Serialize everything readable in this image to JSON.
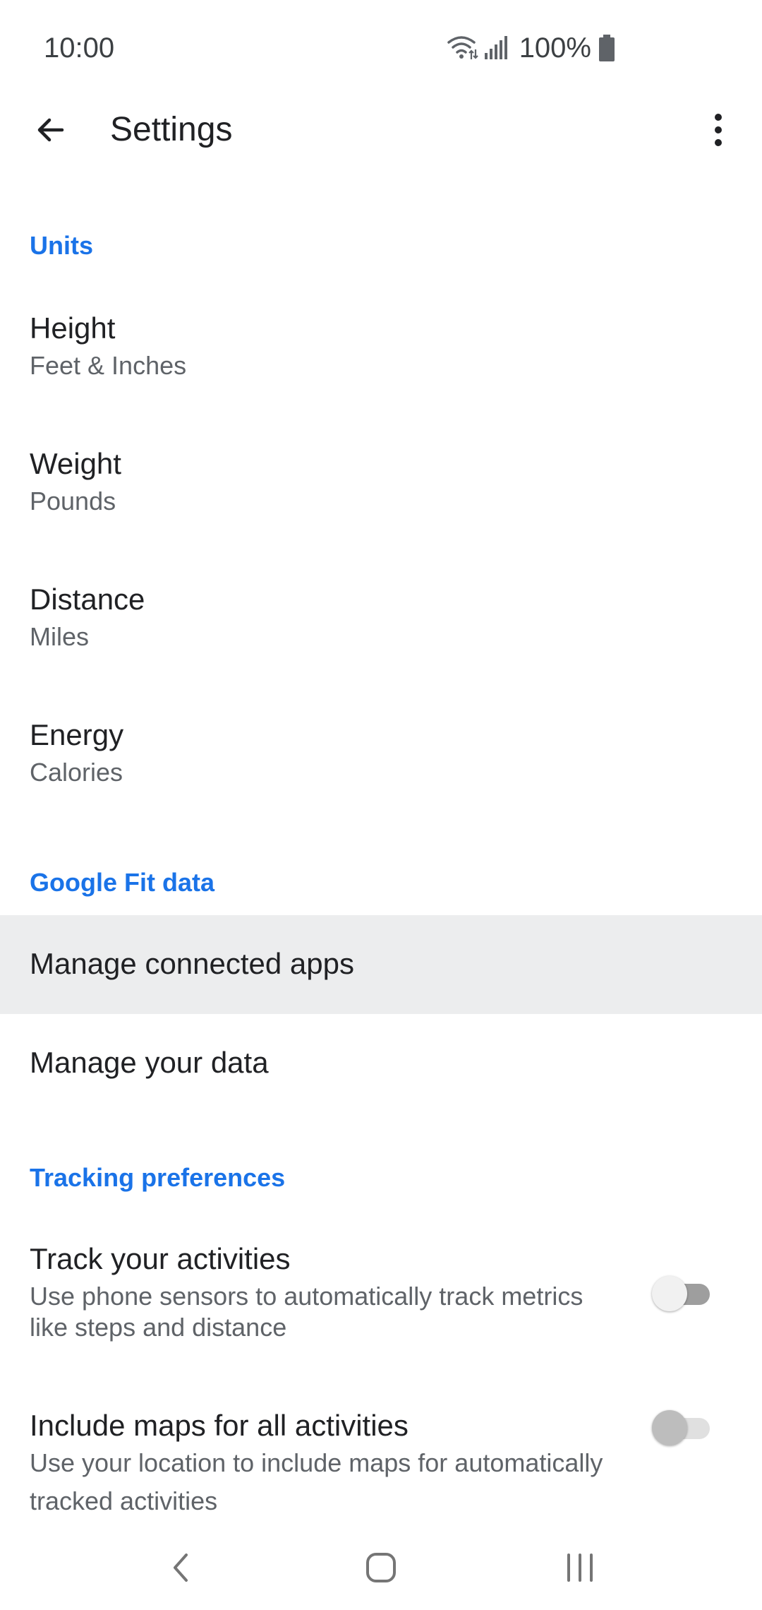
{
  "status_bar": {
    "time": "10:00",
    "battery_percent": "100%",
    "icons": [
      "wifi-icon",
      "signal-icon",
      "battery-icon"
    ]
  },
  "app_bar": {
    "title": "Settings",
    "back_icon": "arrow-back-icon",
    "menu_icon": "more-vert-icon"
  },
  "sections": {
    "units": {
      "header": "Units",
      "items": [
        {
          "title": "Height",
          "value": "Feet & Inches"
        },
        {
          "title": "Weight",
          "value": "Pounds"
        },
        {
          "title": "Distance",
          "value": "Miles"
        },
        {
          "title": "Energy",
          "value": "Calories"
        }
      ]
    },
    "google_fit_data": {
      "header": "Google Fit data",
      "items": [
        {
          "title": "Manage connected apps"
        },
        {
          "title": "Manage your data"
        }
      ]
    },
    "tracking": {
      "header": "Tracking preferences",
      "items": [
        {
          "title": "Track your activities",
          "description_line1": "Use phone sensors to automatically track metrics",
          "description_line2": "like steps and distance",
          "enabled": false
        },
        {
          "title": "Include maps for all activities",
          "description_line1": "Use your location to include maps for automatically",
          "description_line2": "tracked activities",
          "enabled": false
        }
      ]
    }
  },
  "nav_bar": {
    "icons": [
      "nav-back-icon",
      "nav-home-icon",
      "nav-recents-icon"
    ]
  },
  "colors": {
    "accent": "#1a73e8",
    "text_primary": "#202124",
    "text_secondary": "#5f6368",
    "highlight_row": "#ecedee",
    "toggle_track_disabled": "#bdbdbd",
    "toggle_track_off": "#9e9e9e",
    "toggle_thumb_disabled": "#bdbdbd",
    "toggle_thumb_off": "#f1f1f1"
  }
}
